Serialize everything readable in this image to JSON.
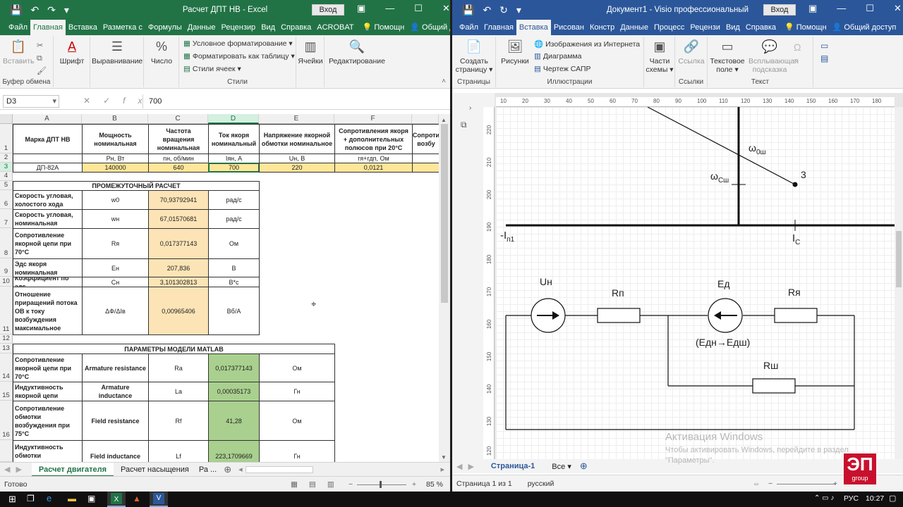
{
  "excel": {
    "title": "Расчет ДПТ НВ - Excel",
    "login": "Вход",
    "tabs": [
      "Файл",
      "Главная",
      "Вставка",
      "Разметка с",
      "Формулы",
      "Данные",
      "Рецензир",
      "Вид",
      "Справка",
      "ACROBAT",
      "Помощн",
      "Общий доступ"
    ],
    "ribbon": {
      "clipboard": {
        "paste": "Вставить",
        "label": "Буфер обмена"
      },
      "font": "Шрифт",
      "align": "Выравнивание",
      "number": "Число",
      "styles": {
        "cond": "Условное форматирование",
        "table": "Форматировать как таблицу",
        "cell": "Стили ячеек",
        "label": "Стили"
      },
      "cells": "Ячейки",
      "edit": "Редактирование"
    },
    "namebox": "D3",
    "formula": "700",
    "columns": [
      "A",
      "B",
      "C",
      "D",
      "E",
      "F"
    ],
    "rows": [
      "1",
      "2",
      "3",
      "4",
      "5",
      "6",
      "7",
      "8",
      "9",
      "10",
      "11",
      "12",
      "13",
      "14",
      "15",
      "16"
    ],
    "header": {
      "a": "Марка ДПТ НВ",
      "b": "Мощность номинальная",
      "c": "Частота вращения номинальная",
      "d": "Ток якоря номинальный",
      "e": "Напряжение якорной обмотки номинальное",
      "f": "Сопротивления якоря + дополнительных полюсов при 20°С",
      "g": "Сопроти возбу"
    },
    "units": {
      "b": "Рн, Вт",
      "c": "nн, об/мин",
      "d": "Iян, А",
      "e": "Uн, В",
      "f": "rя+rдп, Ом"
    },
    "values": {
      "a": "ДП-82А",
      "b": "140000",
      "c": "640",
      "d": "700",
      "e": "220",
      "f": "0,0121"
    },
    "inter_title": "ПРОМЕЖУТОЧНЫЙ РАСЧЕТ",
    "inter": [
      {
        "name": "Скорость угловая, холостого хода",
        "sym": "w0",
        "val": "70,93792941",
        "unit": "рад/с"
      },
      {
        "name": "Скорость угловая, номинальная",
        "sym": "wн",
        "val": "67,01570681",
        "unit": "рад/с"
      },
      {
        "name": "Сопротивление якорной цепи при 70°С",
        "sym": "Rя",
        "val": "0,017377143",
        "unit": "Ом"
      },
      {
        "name": "Эдс якоря номинальная",
        "sym": "Ен",
        "val": "207,836",
        "unit": "В"
      },
      {
        "name": "Коэффициент по эдс",
        "sym": "Сн",
        "val": "3,101302813",
        "unit": "В*с"
      },
      {
        "name": "Отношение приращений потока ОВ к току возбуждения максимальное",
        "sym": "ΔФ/ΔIв",
        "val": "0,00965406",
        "unit": "Вб/А"
      }
    ],
    "matlab_title": "ПАРАМЕТРЫ МОДЕЛИ MATLAB",
    "matlab": [
      {
        "name": "Сопротивление якорной цепи при 70°С",
        "eng": "Armature resistance",
        "sym": "Ra",
        "val": "0,017377143",
        "unit": "Ом"
      },
      {
        "name": "Индуктивность якорной цепи",
        "eng": "Armature inductance",
        "sym": "La",
        "val": "0,00035173",
        "unit": "Гн"
      },
      {
        "name": "Сопротивление обмотки возбуждения при 75°С",
        "eng": "Field resistance",
        "sym": "Rf",
        "val": "41,28",
        "unit": "Ом"
      },
      {
        "name": "Индуктивность обмотки",
        "eng": "Field inductance",
        "sym": "Lf",
        "val": "223,1709669",
        "unit": "Гн"
      }
    ],
    "sheets": [
      "Расчет двигателя",
      "Расчет насыщения",
      "Ра ..."
    ],
    "status": "Готово",
    "zoom": "85 %"
  },
  "visio": {
    "title": "Документ1 - Visio профессиональный",
    "login": "Вход",
    "tabs": [
      "Файл",
      "Главная",
      "Вставка",
      "Рисован",
      "Констр",
      "Данные",
      "Процесс",
      "Рецензи",
      "Вид",
      "Справка",
      "Помощн",
      "Общий доступ"
    ],
    "ribbon": {
      "newpage": "Создать страницу",
      "pages": "Страницы",
      "pictures": "Рисунки",
      "online": "Изображения из Интернета",
      "diagram": "Диаграмма",
      "cad": "Чертеж САПР",
      "illus": "Иллюстрации",
      "parts": "Части схемы",
      "link": "Ссылка",
      "links": "Ссылки",
      "textbox": "Текстовое поле",
      "tooltip": "Всплывающая подсказка",
      "text": "Текст"
    },
    "ruler_h": [
      "10",
      "20",
      "30",
      "40",
      "50",
      "60",
      "70",
      "80",
      "90",
      "100",
      "110",
      "120",
      "130",
      "140",
      "150",
      "160",
      "170",
      "180"
    ],
    "ruler_v": [
      "220",
      "210",
      "200",
      "190",
      "180",
      "170",
      "160",
      "150",
      "140",
      "130",
      "120"
    ],
    "diagram": {
      "w0": "ω",
      "w0_sub": "0ш",
      "wc": "ω",
      "wc_sub": "Cш",
      "point": "3",
      "in1": "-I",
      "in1_sub": "п1",
      "ic": "I",
      "ic_sub": "C",
      "un": "Uн",
      "rp": "Rп",
      "ed": "Ед",
      "ra": "Rя",
      "edn": "(Едн→Едш)",
      "rsh": "Rш"
    },
    "page_tab": "Страница-1",
    "all": "Все",
    "status_page": "Страница 1 из 1",
    "status_lang": "русский"
  },
  "activation": {
    "line1": "Активация Windows",
    "line2": "Чтобы активировать Windows, перейдите в раздел \"Параметры\"."
  },
  "logo": {
    "text": "ЭП",
    "sub": "group"
  },
  "taskbar": {
    "lang": "РУС",
    "time": "10:27"
  }
}
